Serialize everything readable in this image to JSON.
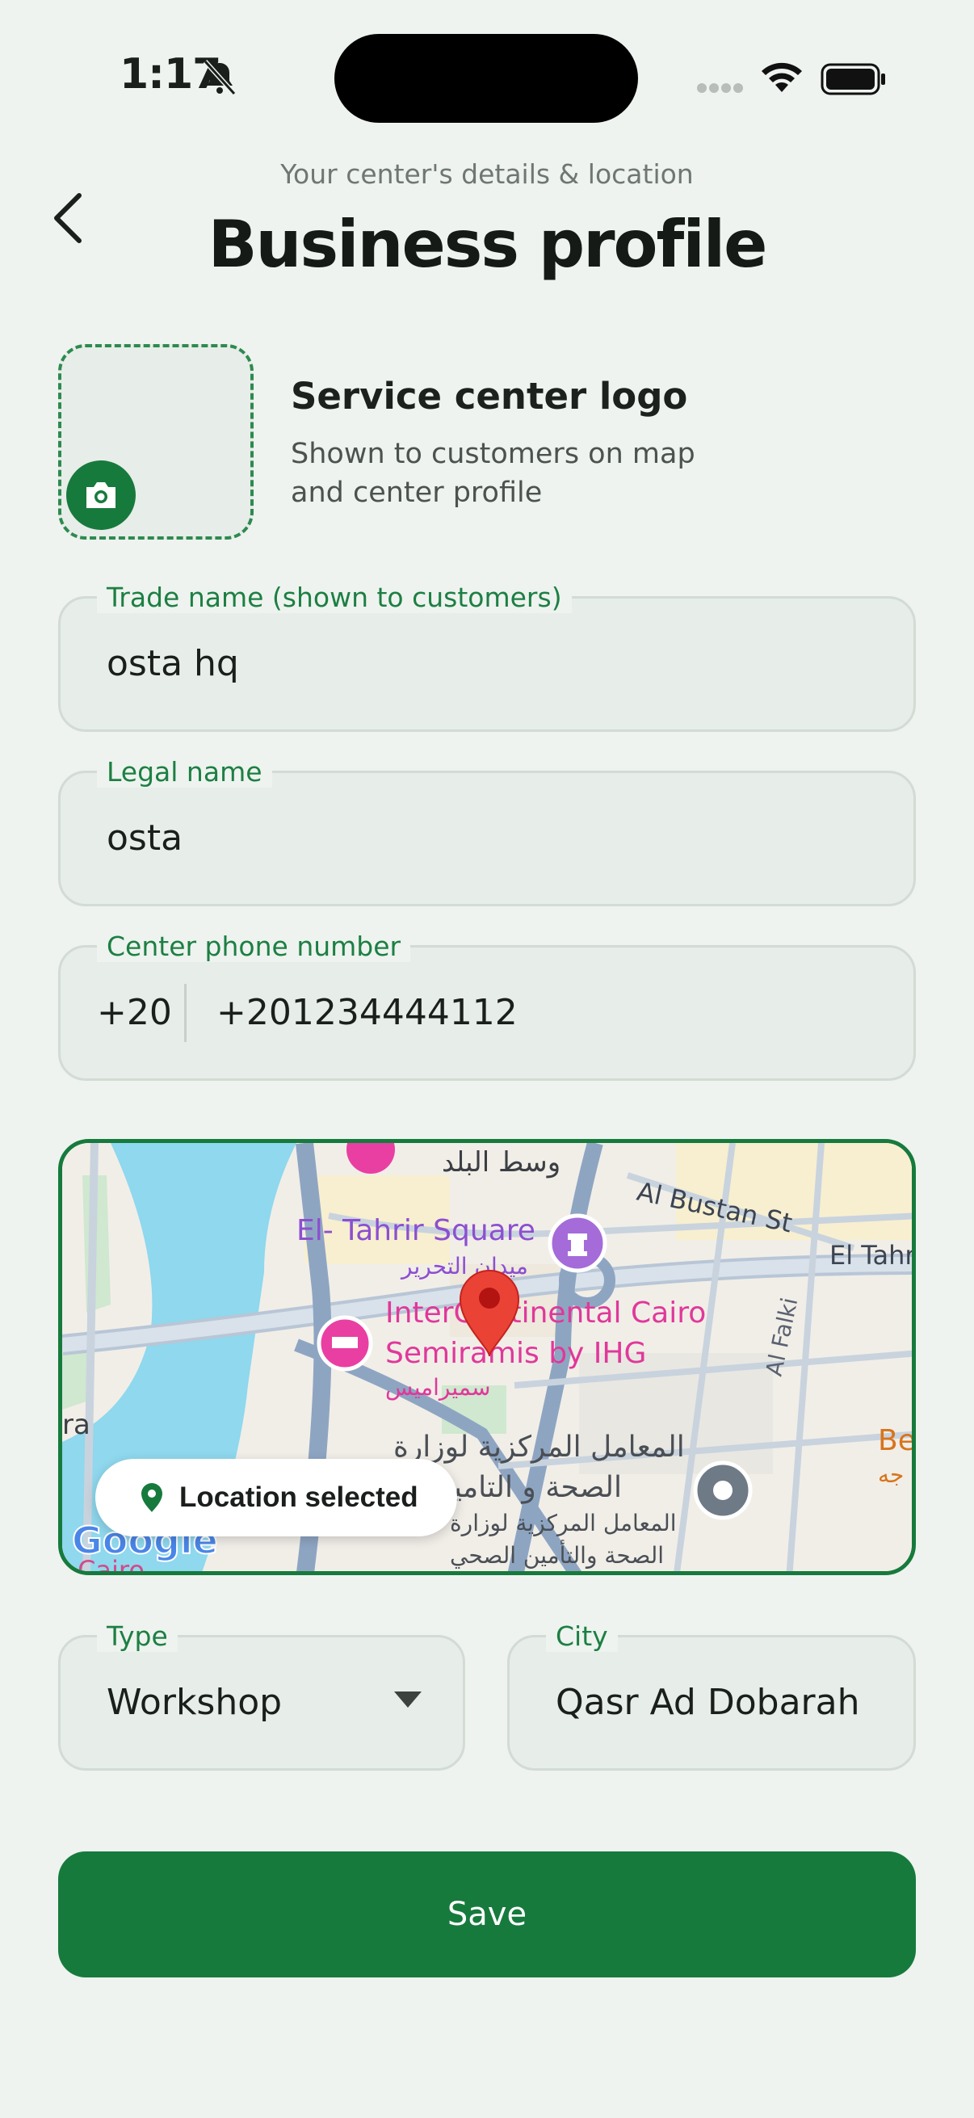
{
  "status_bar": {
    "time": "1:17"
  },
  "header": {
    "subtitle": "Your center's details & location",
    "title": "Business profile"
  },
  "logo_section": {
    "title": "Service center logo",
    "description": "Shown to customers on map and center profile"
  },
  "fields": {
    "trade_name": {
      "label": "Trade name (shown to customers)",
      "value": "osta hq"
    },
    "legal_name": {
      "label": "Legal name",
      "value": "osta"
    },
    "phone": {
      "label": "Center phone number",
      "country_code": "+20",
      "value": "+201234444112"
    },
    "type": {
      "label": "Type",
      "value": "Workshop"
    },
    "city": {
      "label": "City",
      "value": "Qasr Ad Dobarah"
    }
  },
  "map": {
    "chip_label": "Location selected",
    "labels": {
      "downtown_ar": "وسط البلد",
      "bustan": "Al Bustan St",
      "tahrir": "El Tahr",
      "tahrir_sq": "El- Tahrir Square",
      "tahrir_sq_ar": "ميدان التحرير",
      "hotel_1": "InterContinental Cairo",
      "hotel_2": "Semiramis by IHG",
      "hotel_ar": "سميراميس",
      "falki": "Al Falki",
      "lab_ar_1": "المعامل المركزية لوزارة",
      "lab_ar_2": "الصحة و التامين ال",
      "lab_ar_small_1": "المعامل المركزية لوزارة",
      "lab_ar_small_2": "الصحة والتأمين الصحي",
      "edge_left": "ra",
      "edge_right": "Be",
      "edge_right_ar": "جه",
      "google": "Google",
      "cairo": "l Cairo"
    }
  },
  "actions": {
    "save_label": "Save"
  },
  "colors": {
    "primary": "#177a3d",
    "background": "#eef3ef",
    "field_bg": "#e7ede8"
  }
}
